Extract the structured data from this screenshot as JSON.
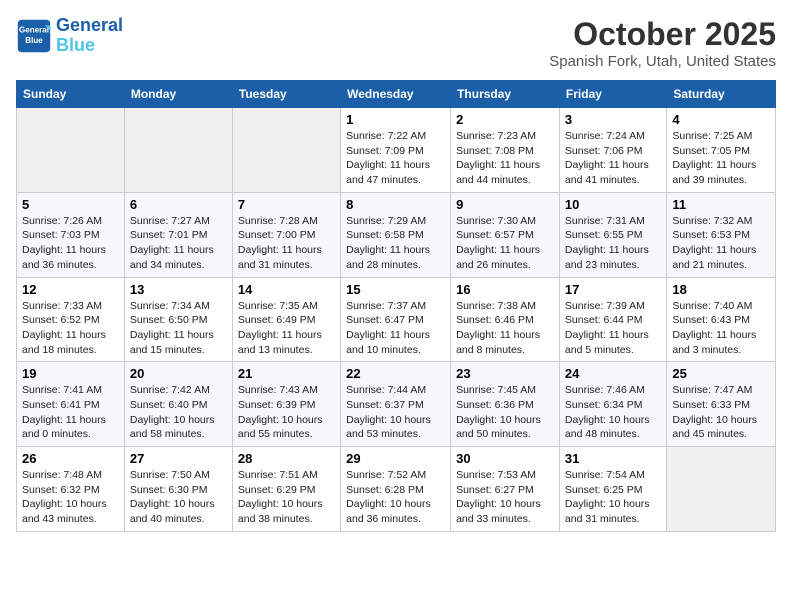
{
  "header": {
    "logo_general": "General",
    "logo_blue": "Blue",
    "month": "October 2025",
    "location": "Spanish Fork, Utah, United States"
  },
  "days_of_week": [
    "Sunday",
    "Monday",
    "Tuesday",
    "Wednesday",
    "Thursday",
    "Friday",
    "Saturday"
  ],
  "weeks": [
    [
      {
        "day": null,
        "num": null,
        "sunrise": null,
        "sunset": null,
        "daylight": null
      },
      {
        "day": null,
        "num": null,
        "sunrise": null,
        "sunset": null,
        "daylight": null
      },
      {
        "day": null,
        "num": null,
        "sunrise": null,
        "sunset": null,
        "daylight": null
      },
      {
        "num": "1",
        "sunrise": "Sunrise: 7:22 AM",
        "sunset": "Sunset: 7:09 PM",
        "daylight": "Daylight: 11 hours and 47 minutes."
      },
      {
        "num": "2",
        "sunrise": "Sunrise: 7:23 AM",
        "sunset": "Sunset: 7:08 PM",
        "daylight": "Daylight: 11 hours and 44 minutes."
      },
      {
        "num": "3",
        "sunrise": "Sunrise: 7:24 AM",
        "sunset": "Sunset: 7:06 PM",
        "daylight": "Daylight: 11 hours and 41 minutes."
      },
      {
        "num": "4",
        "sunrise": "Sunrise: 7:25 AM",
        "sunset": "Sunset: 7:05 PM",
        "daylight": "Daylight: 11 hours and 39 minutes."
      }
    ],
    [
      {
        "num": "5",
        "sunrise": "Sunrise: 7:26 AM",
        "sunset": "Sunset: 7:03 PM",
        "daylight": "Daylight: 11 hours and 36 minutes."
      },
      {
        "num": "6",
        "sunrise": "Sunrise: 7:27 AM",
        "sunset": "Sunset: 7:01 PM",
        "daylight": "Daylight: 11 hours and 34 minutes."
      },
      {
        "num": "7",
        "sunrise": "Sunrise: 7:28 AM",
        "sunset": "Sunset: 7:00 PM",
        "daylight": "Daylight: 11 hours and 31 minutes."
      },
      {
        "num": "8",
        "sunrise": "Sunrise: 7:29 AM",
        "sunset": "Sunset: 6:58 PM",
        "daylight": "Daylight: 11 hours and 28 minutes."
      },
      {
        "num": "9",
        "sunrise": "Sunrise: 7:30 AM",
        "sunset": "Sunset: 6:57 PM",
        "daylight": "Daylight: 11 hours and 26 minutes."
      },
      {
        "num": "10",
        "sunrise": "Sunrise: 7:31 AM",
        "sunset": "Sunset: 6:55 PM",
        "daylight": "Daylight: 11 hours and 23 minutes."
      },
      {
        "num": "11",
        "sunrise": "Sunrise: 7:32 AM",
        "sunset": "Sunset: 6:53 PM",
        "daylight": "Daylight: 11 hours and 21 minutes."
      }
    ],
    [
      {
        "num": "12",
        "sunrise": "Sunrise: 7:33 AM",
        "sunset": "Sunset: 6:52 PM",
        "daylight": "Daylight: 11 hours and 18 minutes."
      },
      {
        "num": "13",
        "sunrise": "Sunrise: 7:34 AM",
        "sunset": "Sunset: 6:50 PM",
        "daylight": "Daylight: 11 hours and 15 minutes."
      },
      {
        "num": "14",
        "sunrise": "Sunrise: 7:35 AM",
        "sunset": "Sunset: 6:49 PM",
        "daylight": "Daylight: 11 hours and 13 minutes."
      },
      {
        "num": "15",
        "sunrise": "Sunrise: 7:37 AM",
        "sunset": "Sunset: 6:47 PM",
        "daylight": "Daylight: 11 hours and 10 minutes."
      },
      {
        "num": "16",
        "sunrise": "Sunrise: 7:38 AM",
        "sunset": "Sunset: 6:46 PM",
        "daylight": "Daylight: 11 hours and 8 minutes."
      },
      {
        "num": "17",
        "sunrise": "Sunrise: 7:39 AM",
        "sunset": "Sunset: 6:44 PM",
        "daylight": "Daylight: 11 hours and 5 minutes."
      },
      {
        "num": "18",
        "sunrise": "Sunrise: 7:40 AM",
        "sunset": "Sunset: 6:43 PM",
        "daylight": "Daylight: 11 hours and 3 minutes."
      }
    ],
    [
      {
        "num": "19",
        "sunrise": "Sunrise: 7:41 AM",
        "sunset": "Sunset: 6:41 PM",
        "daylight": "Daylight: 11 hours and 0 minutes."
      },
      {
        "num": "20",
        "sunrise": "Sunrise: 7:42 AM",
        "sunset": "Sunset: 6:40 PM",
        "daylight": "Daylight: 10 hours and 58 minutes."
      },
      {
        "num": "21",
        "sunrise": "Sunrise: 7:43 AM",
        "sunset": "Sunset: 6:39 PM",
        "daylight": "Daylight: 10 hours and 55 minutes."
      },
      {
        "num": "22",
        "sunrise": "Sunrise: 7:44 AM",
        "sunset": "Sunset: 6:37 PM",
        "daylight": "Daylight: 10 hours and 53 minutes."
      },
      {
        "num": "23",
        "sunrise": "Sunrise: 7:45 AM",
        "sunset": "Sunset: 6:36 PM",
        "daylight": "Daylight: 10 hours and 50 minutes."
      },
      {
        "num": "24",
        "sunrise": "Sunrise: 7:46 AM",
        "sunset": "Sunset: 6:34 PM",
        "daylight": "Daylight: 10 hours and 48 minutes."
      },
      {
        "num": "25",
        "sunrise": "Sunrise: 7:47 AM",
        "sunset": "Sunset: 6:33 PM",
        "daylight": "Daylight: 10 hours and 45 minutes."
      }
    ],
    [
      {
        "num": "26",
        "sunrise": "Sunrise: 7:48 AM",
        "sunset": "Sunset: 6:32 PM",
        "daylight": "Daylight: 10 hours and 43 minutes."
      },
      {
        "num": "27",
        "sunrise": "Sunrise: 7:50 AM",
        "sunset": "Sunset: 6:30 PM",
        "daylight": "Daylight: 10 hours and 40 minutes."
      },
      {
        "num": "28",
        "sunrise": "Sunrise: 7:51 AM",
        "sunset": "Sunset: 6:29 PM",
        "daylight": "Daylight: 10 hours and 38 minutes."
      },
      {
        "num": "29",
        "sunrise": "Sunrise: 7:52 AM",
        "sunset": "Sunset: 6:28 PM",
        "daylight": "Daylight: 10 hours and 36 minutes."
      },
      {
        "num": "30",
        "sunrise": "Sunrise: 7:53 AM",
        "sunset": "Sunset: 6:27 PM",
        "daylight": "Daylight: 10 hours and 33 minutes."
      },
      {
        "num": "31",
        "sunrise": "Sunrise: 7:54 AM",
        "sunset": "Sunset: 6:25 PM",
        "daylight": "Daylight: 10 hours and 31 minutes."
      },
      {
        "day": null,
        "num": null,
        "sunrise": null,
        "sunset": null,
        "daylight": null
      }
    ]
  ]
}
